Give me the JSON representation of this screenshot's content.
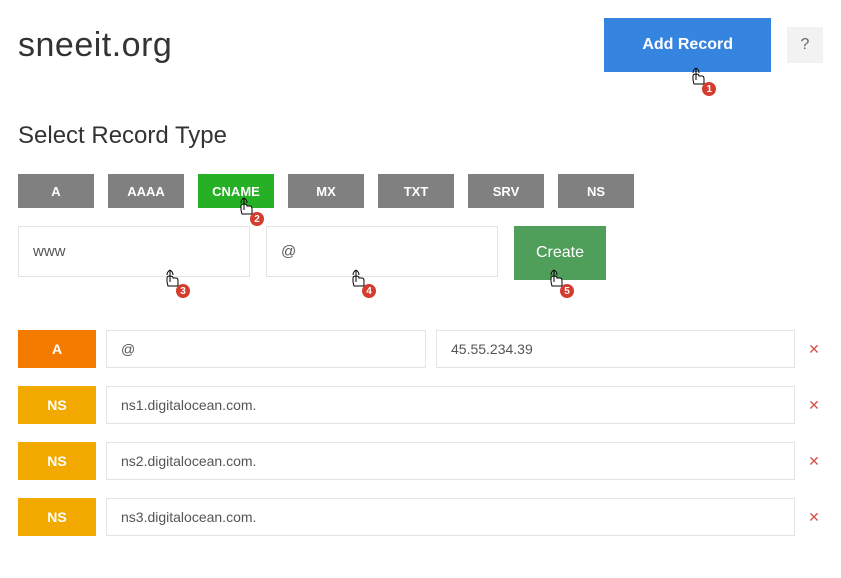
{
  "header": {
    "domain": "sneeit.org",
    "add_record_label": "Add Record",
    "help_label": "?"
  },
  "section_title": "Select Record Type",
  "types": [
    "A",
    "AAAA",
    "CNAME",
    "MX",
    "TXT",
    "SRV",
    "NS"
  ],
  "active_type_index": 2,
  "form": {
    "hostname_value": "www",
    "target_value": "@",
    "create_label": "Create"
  },
  "records": [
    {
      "type": "A",
      "name": "@",
      "value": "45.55.234.39"
    },
    {
      "type": "NS",
      "name": "ns1.digitalocean.com."
    },
    {
      "type": "NS",
      "name": "ns2.digitalocean.com."
    },
    {
      "type": "NS",
      "name": "ns3.digitalocean.com."
    }
  ],
  "annotations": [
    "1",
    "2",
    "3",
    "4",
    "5"
  ]
}
